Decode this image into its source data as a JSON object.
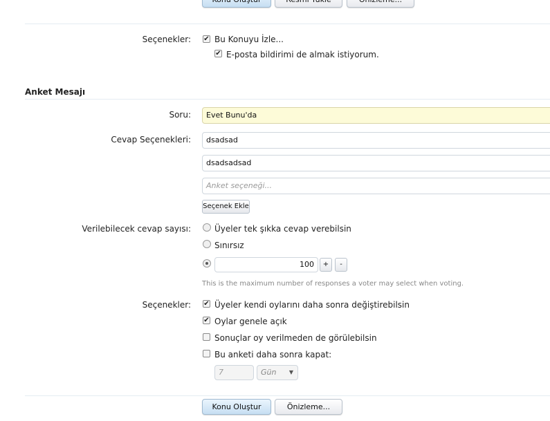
{
  "top_buttons": {
    "create": "Konu Oluştur",
    "attach": "Resmi Yükle",
    "preview": "Önizleme..."
  },
  "options1": {
    "label": "Seçenekler:",
    "watch": "Bu Konuyu İzle...",
    "email": "E-posta bildirimi de almak istiyorum."
  },
  "poll": {
    "section_title": "Anket Mesajı",
    "question_label": "Soru:",
    "question_value": "Evet Bunu'da",
    "answers_label": "Cevap Seçenekleri:",
    "answers": [
      "dsadsad",
      "dsadsadsad"
    ],
    "answer_placeholder": "Anket seçeneği...",
    "add_option": "Seçenek Ekle",
    "max_label": "Verilebilecek cevap sayısı:",
    "max_single": "Üyeler tek şıkka cevap verebilsin",
    "max_unlimited": "Sınırsız",
    "max_value": "100",
    "plus": "+",
    "minus": "-",
    "max_help": "This is the maximum number of responses a voter may select when voting.",
    "options_label": "Seçenekler:",
    "opt_change": "Üyeler kendi oylarını daha sonra değiştirebilsin",
    "opt_public": "Oylar genele açık",
    "opt_results": "Sonuçlar oy verilmeden de görülebilsin",
    "opt_close": "Bu anketi daha sonra kapat:",
    "close_value": "7",
    "close_unit": "Gün"
  },
  "bottom_buttons": {
    "create": "Konu Oluştur",
    "preview": "Önizleme..."
  },
  "colors": {
    "question_bg": "#fdfbd8",
    "help_text": "#888888",
    "separator": "#e4ecf2"
  }
}
